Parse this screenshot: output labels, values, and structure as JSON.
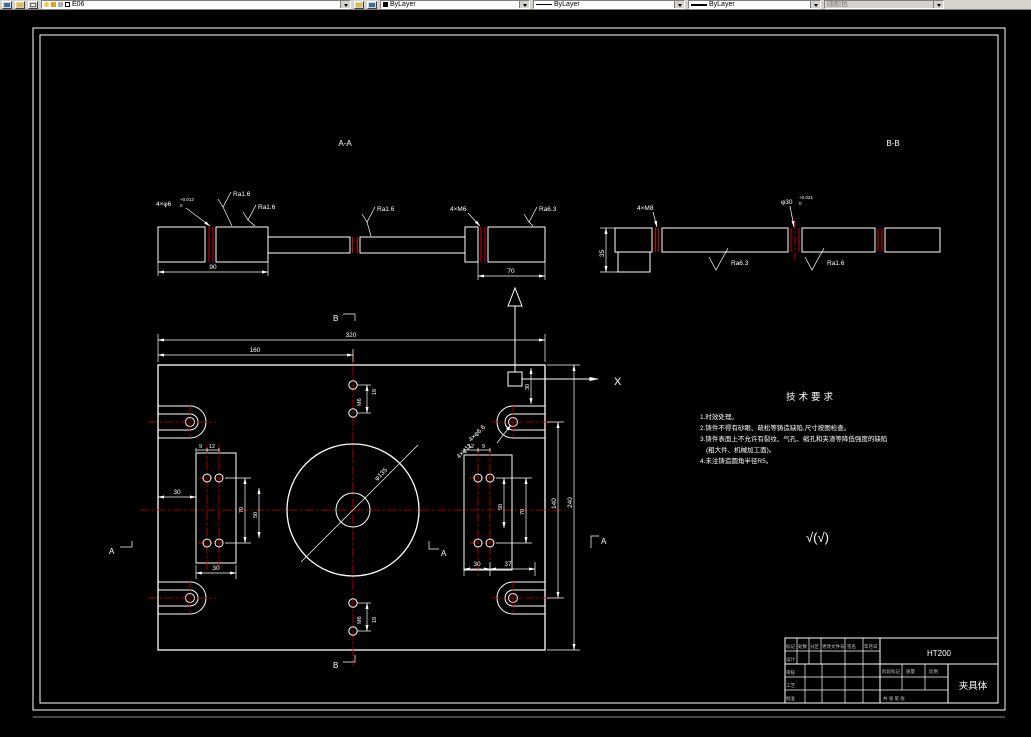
{
  "toolbar": {
    "layer": "E06",
    "color": "ByLayer",
    "linetype": "ByLayer",
    "lineweight": "ByLayer",
    "plotstyle": "随颜色"
  },
  "sectionA": {
    "title": "A-A",
    "hole_label": "4×φ6",
    "hole_tol_sup": "+0.012",
    "hole_tol_sub": "0",
    "ra_1": "Ra1.6",
    "ra_2": "Ra1.6",
    "ra_3": "Ra1.6",
    "thread_label": "4×M6",
    "ra_4": "Ra6.3",
    "dim_90": "90",
    "dim_70": "70"
  },
  "sectionB": {
    "title": "B-B",
    "dim_35": "35",
    "thread_label": "4×M8",
    "bore_label": "φ30",
    "bore_tol_sup": "+0.021",
    "bore_tol_sub": "0",
    "ra_left": "Ra6.3",
    "ra_right": "Ra1.6"
  },
  "plan": {
    "dim_320": "320",
    "dim_160": "160",
    "dim_140": "140",
    "dim_240": "240",
    "dim_30_topright": "30",
    "cbore_label_1": "4×φ6.6",
    "cbore_label_2": "4×φ11",
    "left_dim_9": "9",
    "left_dim_12": "12",
    "left_dim_70": "70",
    "left_dim_50": "50",
    "left_dim_30_bottom": "30",
    "left_dim_30_side": "30",
    "right_dim_12": "12",
    "right_dim_9": "9",
    "right_dim_50": "50",
    "right_dim_70": "70",
    "right_dim_30": "30",
    "right_dim_37": "37",
    "bore_dia": "φ135",
    "m6_top": "M6",
    "dim_18_top": "18",
    "m6_bottom": "M6",
    "dim_18_bottom": "18",
    "marker_b": "B",
    "marker_a": "A",
    "ucs_x_label": "X"
  },
  "tech": {
    "title": "技术要求",
    "lines": [
      "1.时效处理。",
      "2.铸件不得有砂眼、疏松等铸造缺陷,尺寸按图检查。",
      "3.铸件表面上不允许有裂纹、气孔、缩孔和夹渣等降低强度的缺陷",
      "(粗大件、机械加工面)。",
      "4.未注铸造圆角半径R5。"
    ],
    "finish_note": "√(√)"
  },
  "titleblock": {
    "material": "HT200",
    "part_name": "夹具体",
    "header_cells": [
      "标记",
      "处数",
      "分区",
      "更改文件号",
      "签名",
      "年月日"
    ],
    "row_labels": [
      "设计",
      "审核",
      "工艺",
      "批准"
    ],
    "stage_label": "阶段标记",
    "weight_label": "质量",
    "scale_label": "比例",
    "sheet_label": "共 张 第 张"
  }
}
